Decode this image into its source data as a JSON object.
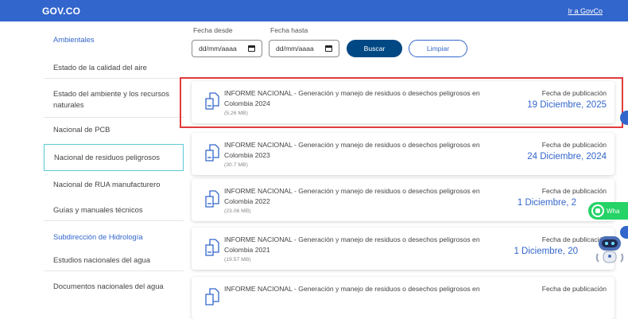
{
  "topbar": {
    "logo": "GOV.CO",
    "link": "Ir a GovCo",
    "bg_color": "#3366cc"
  },
  "sidebar": {
    "items": [
      {
        "label": "Ambientales",
        "type": "section"
      },
      {
        "label": "Estado de la calidad del aire",
        "type": "item"
      },
      {
        "label": "Estado del ambiente y los recursos naturales",
        "type": "item"
      },
      {
        "label": "Nacional de PCB",
        "type": "item"
      },
      {
        "label": "Nacional de residuos peligrosos",
        "type": "selected"
      },
      {
        "label": "Nacional de RUA manufacturero",
        "type": "item"
      },
      {
        "label": "Guías y manuales técnicos",
        "type": "item"
      },
      {
        "label": "Subdirección de Hidrología",
        "type": "section"
      },
      {
        "label": "Estudios nacionales del agua",
        "type": "item"
      },
      {
        "label": "Documentos nacionales del agua",
        "type": "item"
      }
    ]
  },
  "filters": {
    "from_label": "Fecha desde",
    "to_label": "Fecha hasta",
    "from_value": "dd/mm/aaaa",
    "to_value": "dd/mm/aaaa",
    "search_button": "Buscar",
    "clear_button": "Limpiar"
  },
  "reports": [
    {
      "title": "INFORME NACIONAL - Generación y manejo de residuos o desechos peligrosos en",
      "title2": "Colombia 2024",
      "size": "(5.26 MB)",
      "pub_label": "Fecha de publicación",
      "pub_date": "19 Diciembre, 2025"
    },
    {
      "title": "INFORME NACIONAL - Generación y manejo de residuos o desechos peligrosos en",
      "title2": "Colombia 2023",
      "size": "(30.7 MB)",
      "pub_label": "Fecha de publicación",
      "pub_date": "24 Diciembre, 2024"
    },
    {
      "title": "INFORME NACIONAL - Generación y manejo de residuos o desechos peligrosos en",
      "title2": "Colombia 2022",
      "size": "(23.06 MB)",
      "pub_label": "Fecha de publicación",
      "pub_date": "1 Diciembre, 2"
    },
    {
      "title": "INFORME NACIONAL - Generación y manejo de residuos o desechos peligrosos en",
      "title2": "Colombia 2021",
      "size": "(19.57 MB)",
      "pub_label": "Fecha de publicación",
      "pub_date": "1 Diciembre, 20"
    },
    {
      "title": "INFORME NACIONAL - Generación y manejo de residuos o desechos peligrosos en",
      "title2": "",
      "size": "",
      "pub_label": "Fecha de publicación",
      "pub_date": ""
    }
  ],
  "widgets": {
    "whatsapp_label": "Wha"
  },
  "colors": {
    "accent": "#3366cc",
    "primary_button": "#004884",
    "highlight": "#e23b3b",
    "selected_border": "#5bc9d4",
    "whatsapp": "#25d366"
  }
}
